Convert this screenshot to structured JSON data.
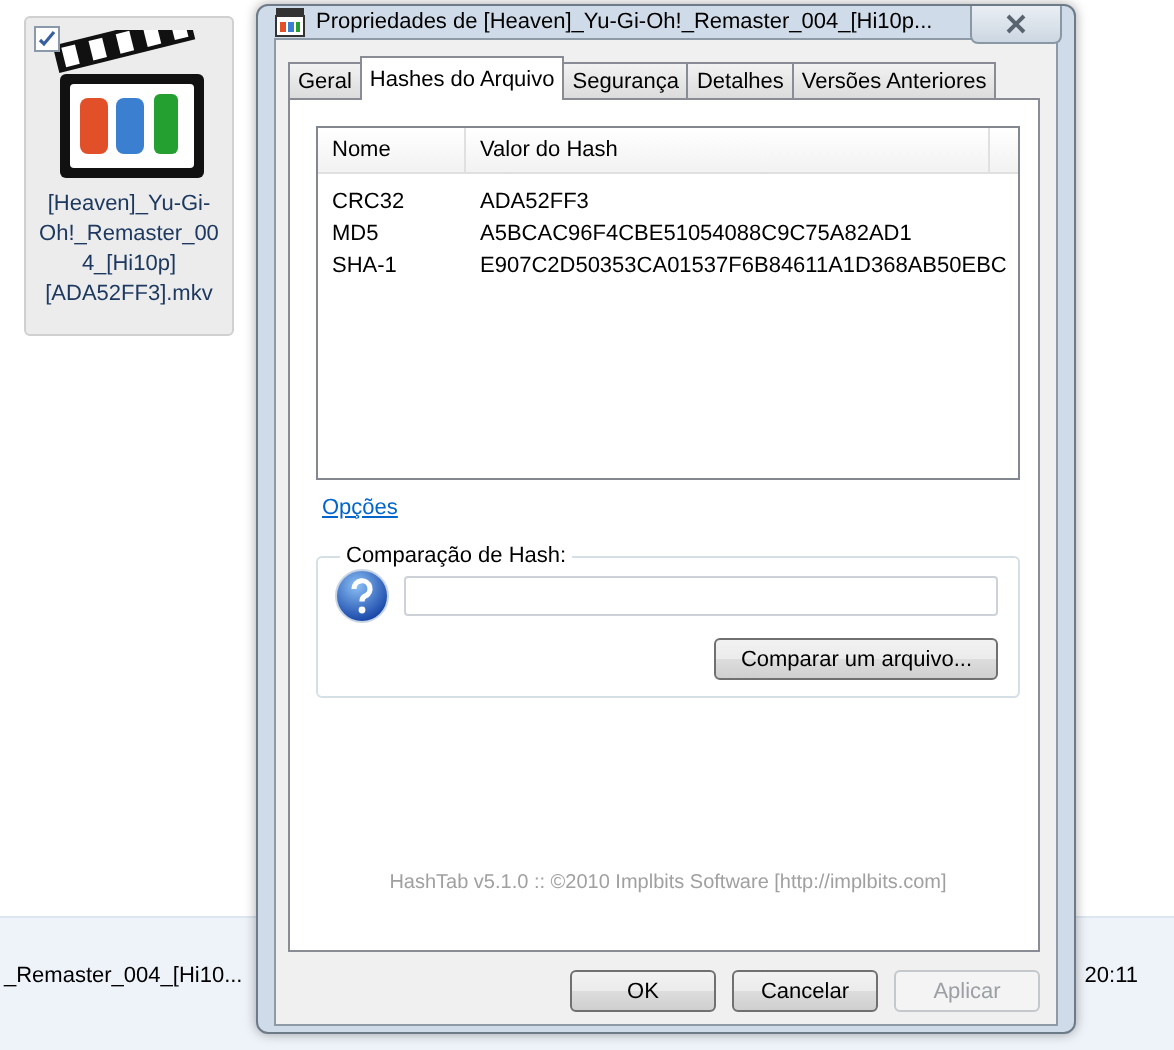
{
  "desktop_item": {
    "checked": true,
    "selected": true,
    "label_lines": [
      "[Heaven]_Yu-Gi-",
      "Oh!_Remaster_00",
      "4_[Hi10p]",
      "[ADA52FF3].mkv"
    ]
  },
  "details_bar": {
    "name": "_Remaster_004_[Hi10...",
    "time": "20:11"
  },
  "window": {
    "title": "Propriedades de [Heaven]_Yu-Gi-Oh!_Remaster_004_[Hi10p..."
  },
  "tabs": [
    {
      "label": "Geral",
      "selected": false
    },
    {
      "label": "Hashes do Arquivo",
      "selected": true
    },
    {
      "label": "Segurança",
      "selected": false
    },
    {
      "label": "Detalhes",
      "selected": false
    },
    {
      "label": "Versões Anteriores",
      "selected": false
    }
  ],
  "table": {
    "columns": [
      "Nome",
      "Valor do Hash"
    ],
    "rows": [
      {
        "name": "CRC32",
        "value": "ADA52FF3"
      },
      {
        "name": "MD5",
        "value": "A5BCAC96F4CBE51054088C9C75A82AD1"
      },
      {
        "name": "SHA-1",
        "value": "E907C2D50353CA01537F6B84611A1D368AB50EBC"
      }
    ]
  },
  "options_link": "Opções",
  "compare_group": {
    "title": "Comparação de Hash:",
    "button": "Comparar um arquivo..."
  },
  "footer": "HashTab v5.1.0 :: ©2010 Implbits Software [http://implbits.com]",
  "buttons": [
    {
      "label": "OK",
      "disabled": false
    },
    {
      "label": "Cancelar",
      "disabled": false
    },
    {
      "label": "Aplicar",
      "disabled": true
    }
  ]
}
